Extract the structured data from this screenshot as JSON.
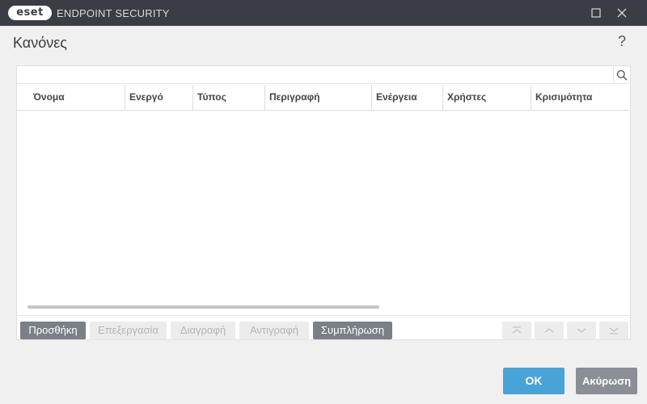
{
  "window": {
    "logo_text": "eset",
    "product_name": "ENDPOINT SECURITY",
    "controls": [
      "maximize-icon",
      "close-icon"
    ]
  },
  "page": {
    "title": "Κανόνες",
    "help_label": "?"
  },
  "search": {
    "value": "",
    "placeholder": "",
    "icon": "search-icon"
  },
  "table": {
    "columns": [
      "Όνομα",
      "Ενεργό",
      "Τύπος",
      "Περιγραφή",
      "Ενέργεια",
      "Χρήστες",
      "Κρισιμότητα"
    ],
    "rows": []
  },
  "toolbar": {
    "add": "Προσθήκη",
    "edit": "Επεξεργασία",
    "delete": "Διαγραφή",
    "copy": "Αντιγραφή",
    "populate": "Συμπλήρωση",
    "enabled": [
      "add",
      "populate"
    ],
    "move_buttons": [
      "move-top-icon",
      "move-up-icon",
      "move-down-icon",
      "move-bottom-icon"
    ]
  },
  "footer": {
    "ok": "OK",
    "cancel": "Ακύρωση"
  },
  "colors": {
    "titlebar": "#3a3d44",
    "primary": "#4aa3d6",
    "secondary": "#8a8e96"
  }
}
